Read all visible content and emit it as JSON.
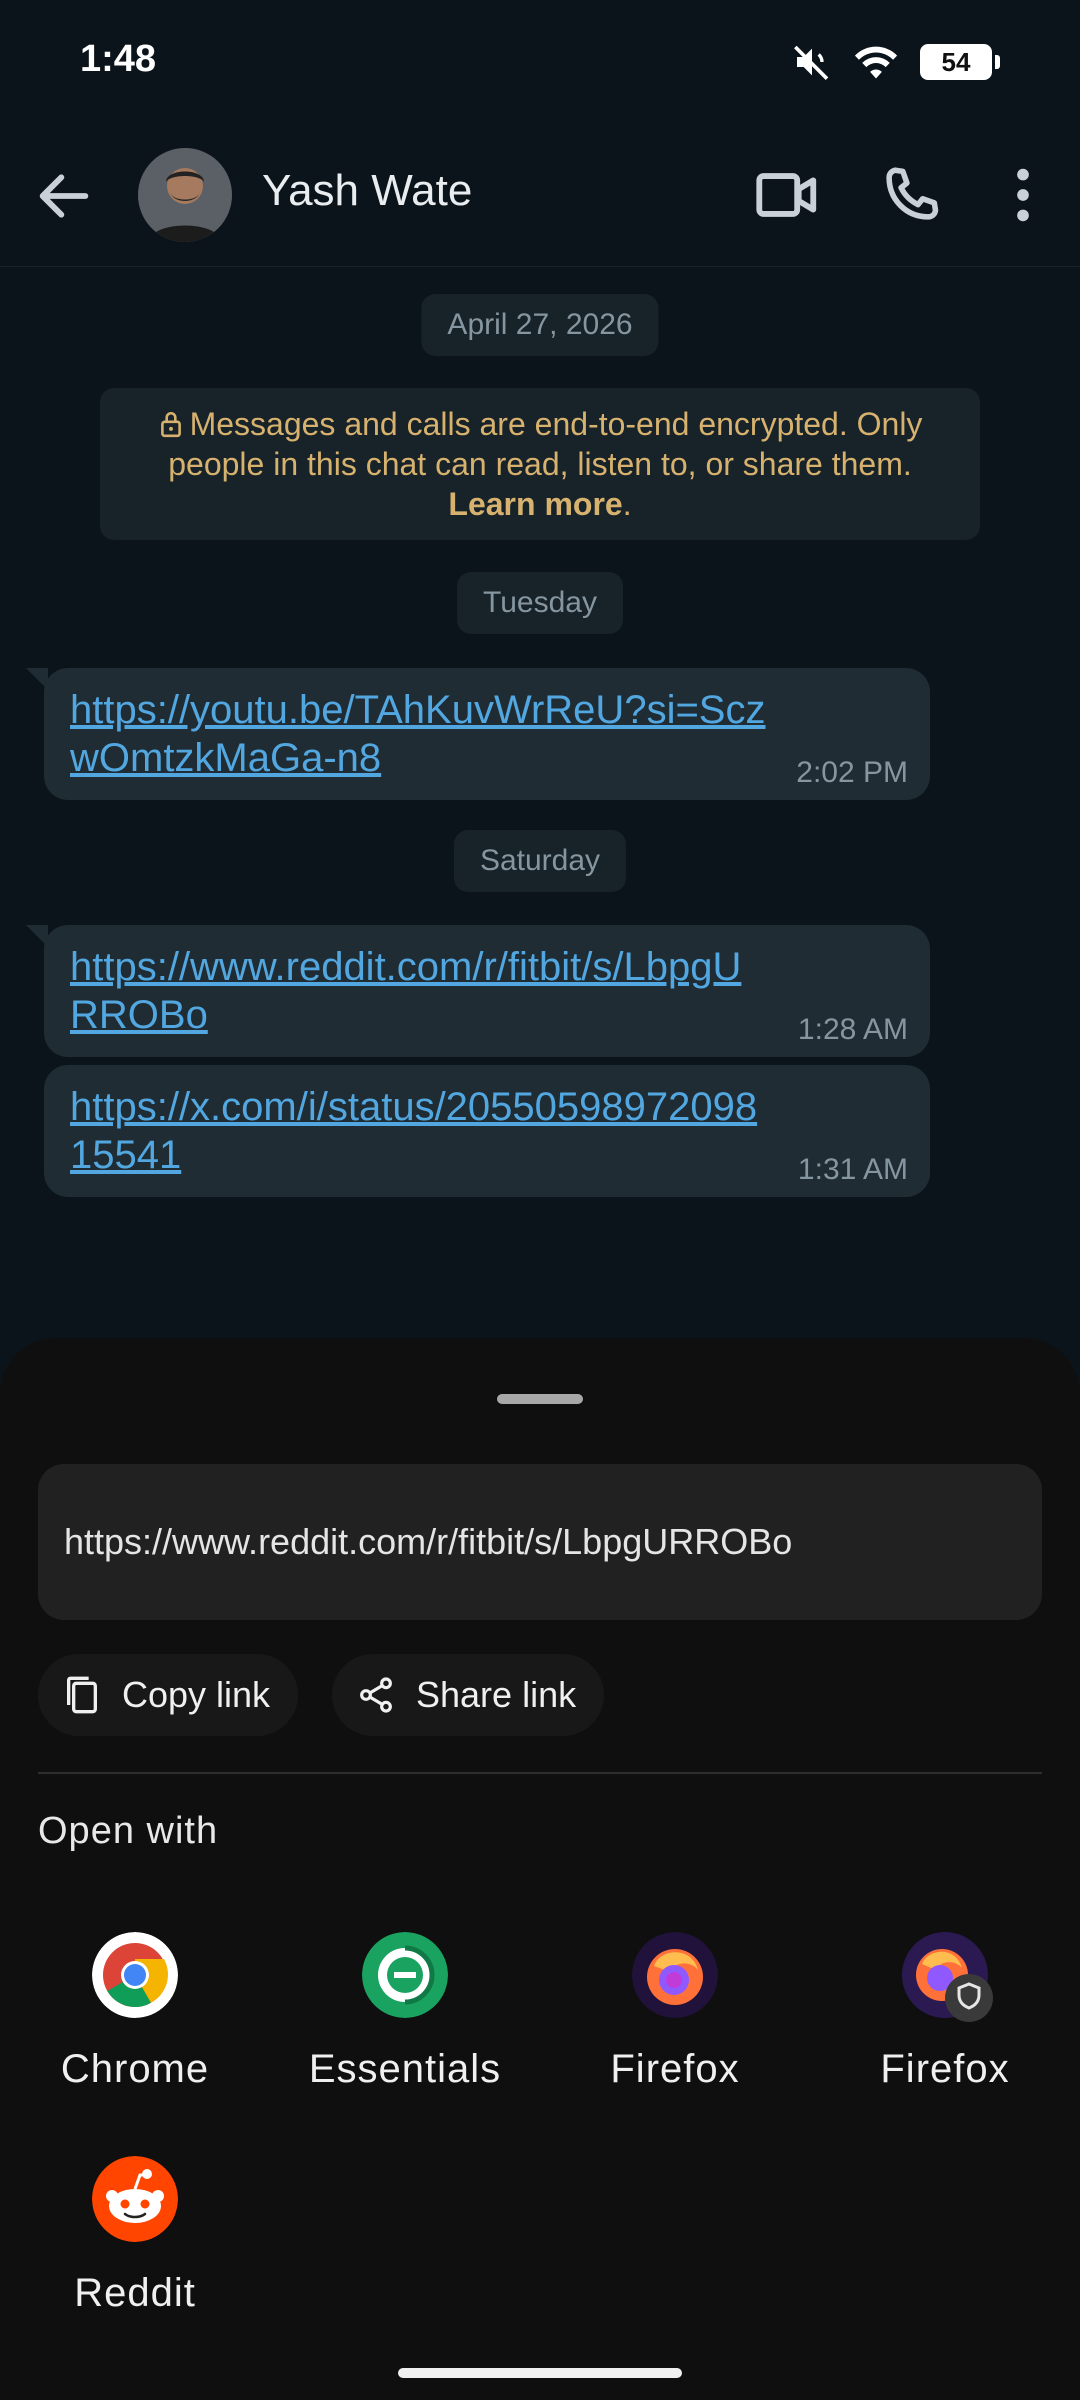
{
  "status_bar": {
    "time": "1:48",
    "battery": "54"
  },
  "header": {
    "contact_name": "Yash Wate"
  },
  "chat": {
    "date_top": "April 27, 2026",
    "encryption_text": "Messages and calls are end-to-end encrypted. Only people in this chat can read, listen to, or share them.",
    "learn_more": "Learn more",
    "day1": "Tuesday",
    "day2": "Saturday",
    "messages": [
      {
        "text": "https://youtu.be/TAhKuvWrReU?si=SczwOmtzkMaGa-n8",
        "time": "2:02 PM"
      },
      {
        "text": "https://www.reddit.com/r/fitbit/s/LbpgURROBo",
        "time": "1:28 AM"
      },
      {
        "text": "https://x.com/i/status/2055059897209815541",
        "time": "1:31 AM"
      }
    ]
  },
  "sheet": {
    "url": "https://www.reddit.com/r/fitbit/s/LbpgURROBo",
    "copy_link": "Copy link",
    "share_link": "Share link",
    "open_with": "Open with",
    "apps": [
      {
        "label": "Chrome",
        "icon": "chrome-icon"
      },
      {
        "label": "Essentials",
        "icon": "essentials-icon"
      },
      {
        "label": "Firefox",
        "icon": "firefox-icon"
      },
      {
        "label": "Firefox",
        "icon": "firefox-focus-icon"
      },
      {
        "label": "Reddit",
        "icon": "reddit-icon"
      }
    ]
  }
}
